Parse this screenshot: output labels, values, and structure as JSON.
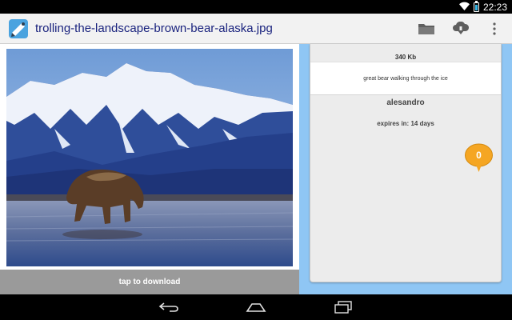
{
  "status_bar": {
    "time": "22:23"
  },
  "action_bar": {
    "title": "trolling-the-landscape-brown-bear-alaska.jpg",
    "icons": [
      "app-logo-icon",
      "folder-icon",
      "cloud-download-icon",
      "overflow-menu-icon"
    ]
  },
  "image_panel": {
    "download_label": "tap to download"
  },
  "details": {
    "file_size": "340 Kb",
    "description": "great bear walking through the ice",
    "author": "alesandro",
    "expires": "expires in: 14 days",
    "comment_count": "0"
  },
  "colors": {
    "content_background": "#8fc6f4",
    "title_text": "#1a237e",
    "comment_bubble": "#f5a623",
    "download_bar": "#9a9a9a"
  }
}
